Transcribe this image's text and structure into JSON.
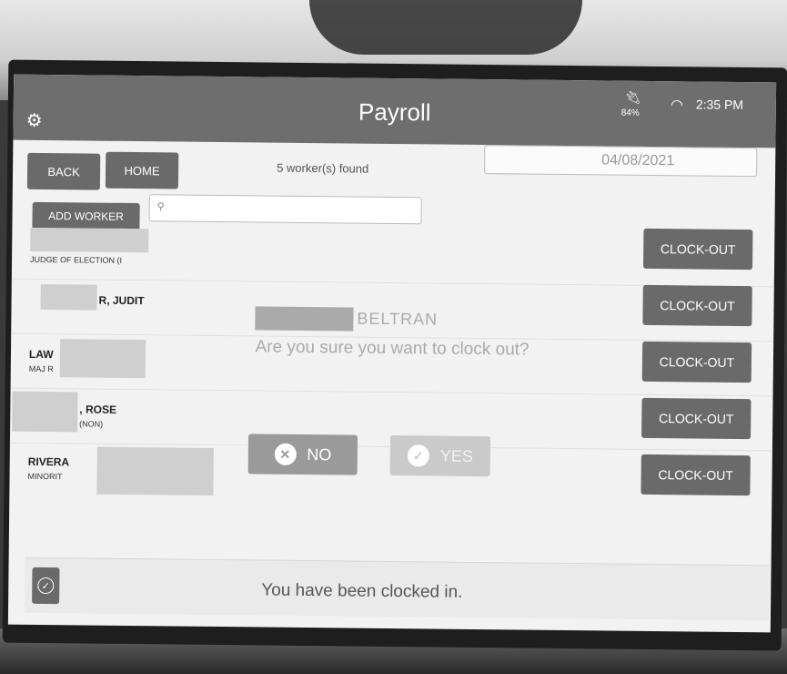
{
  "header": {
    "title": "Payroll",
    "battery": "84%",
    "time": "2:35 PM"
  },
  "toolbar": {
    "back_label": "BACK",
    "home_label": "HOME",
    "add_worker_label": "ADD WORKER",
    "workers_found": "5 worker(s) found",
    "date": "04/08/2021",
    "search_placeholder": ""
  },
  "workers": [
    {
      "name": "",
      "role": "JUDGE OF ELECTION (I",
      "action": "CLOCK-OUT"
    },
    {
      "name": "R, JUDIT",
      "role": "",
      "action": "CLOCK-OUT"
    },
    {
      "name": "LAW",
      "role": "MAJ R",
      "action": "CLOCK-OUT"
    },
    {
      "name": ", ROSE",
      "role": "(NON)",
      "action": "CLOCK-OUT"
    },
    {
      "name": "RIVERA",
      "role": "MINORIT",
      "action": "CLOCK-OUT"
    }
  ],
  "modal": {
    "name": "BELTRAN",
    "question": "Are you sure you want to clock out?",
    "no_label": "NO",
    "yes_label": "YES"
  },
  "toast": {
    "message": "You have been clocked in."
  },
  "icons": {
    "settings": "gear-icon",
    "power": "plug-icon",
    "wifi": "wifi-icon",
    "search": "search-icon",
    "no": "x-circle-icon",
    "yes": "check-circle-icon",
    "toast": "check-circle-icon"
  }
}
